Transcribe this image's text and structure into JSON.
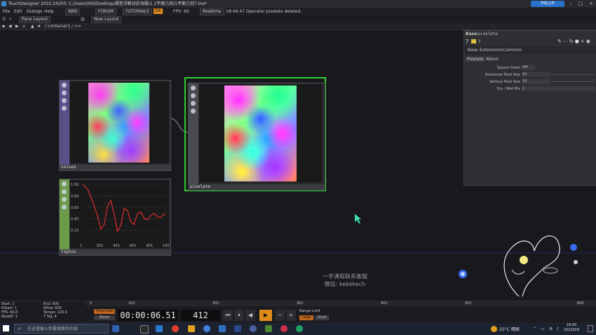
{
  "titlebar": {
    "title": "TouchDesigner 2022.24200: C:/Users/Hill/Desktop/课堂详解动态海报/1.1平面几何/1平面几何7.toe*",
    "upload_label": "开始上传"
  },
  "menubar": {
    "items": [
      "File",
      "Edit",
      "Dialogs",
      "Help"
    ],
    "wiki": "WIKI",
    "forum": "FORUM",
    "tutorials": "TUTORIALS",
    "ok_badge": "OK",
    "fps_label": "FPS:",
    "fps_value": "60",
    "realtime": "Realtime",
    "status_message": "18:46:47 Operator pixelate deleted."
  },
  "toolbar2": {
    "pane_layout": "Pane Layout",
    "new_layout": "New Layout"
  },
  "pathbar": {
    "path": "/ container1 / >>"
  },
  "nodes": {
    "noise": {
      "label": "noise1"
    },
    "pixelate": {
      "label": "pixelate"
    },
    "chop": {
      "label": "topto1",
      "y_ticks": [
        "1.00",
        "0.80",
        "0.60",
        "0.40",
        "0.20"
      ],
      "x_ticks": [
        "1",
        "201",
        "401",
        "601",
        "801",
        "100"
      ]
    }
  },
  "chart_data": {
    "type": "line",
    "title": "",
    "xlabel": "",
    "ylabel": "",
    "xlim": [
      1,
      1000
    ],
    "ylim": [
      0.0,
      1.0
    ],
    "series": [
      {
        "color": "#ff3030",
        "x": [
          1,
          60,
          120,
          180,
          220,
          260,
          300,
          340,
          380,
          420,
          460,
          500,
          540,
          580,
          620,
          660,
          700,
          740,
          780,
          820,
          860,
          900,
          940,
          980,
          1000
        ],
        "y": [
          1.0,
          0.92,
          0.7,
          0.45,
          0.22,
          0.3,
          0.62,
          0.72,
          0.48,
          0.18,
          0.28,
          0.58,
          0.55,
          0.35,
          0.3,
          0.48,
          0.52,
          0.42,
          0.38,
          0.45,
          0.5,
          0.44,
          0.42,
          0.48,
          0.47
        ]
      }
    ]
  },
  "param_panel": {
    "header_type": "Base",
    "header_name": "pixelate",
    "tabs": [
      "Base",
      "Extensions",
      "Common"
    ],
    "subtabs": [
      "Pixelate",
      "About"
    ],
    "params": [
      {
        "label": "Square Pixels",
        "value": "Off"
      },
      {
        "label": "Horizontal Pixel Size",
        "value": "10"
      },
      {
        "label": "Vertical Pixel Size",
        "value": "10"
      },
      {
        "label": "Dry / Wet Mix",
        "value": "1"
      }
    ]
  },
  "watermark": {
    "line1": "一手课程联系客服",
    "line2": "微信: kekekech"
  },
  "timeline": {
    "stats": [
      {
        "label": "Start:",
        "value": "1"
      },
      {
        "label": "RStart:",
        "value": "1"
      },
      {
        "label": "FPS:",
        "value": "60.0"
      },
      {
        "label": "ResetF:",
        "value": "1"
      }
    ],
    "stats2": [
      {
        "label": "End:",
        "value": "600"
      },
      {
        "label": "REnd:",
        "value": "600"
      },
      {
        "label": "Tempo:",
        "value": "120.0"
      },
      {
        "label": "T Sig:",
        "value": "4"
      }
    ],
    "timecode_label": "TimeCode",
    "beats_label": "Beats",
    "timecode": "00:00:06.51",
    "frame": "412",
    "range_limit": "Range Limit",
    "loop": "Loop",
    "once": "Once",
    "ruler_ticks": [
      "1",
      "101",
      "201",
      "301",
      "401",
      "501",
      "600"
    ]
  },
  "taskbar": {
    "search_placeholder": "在这里输入你要搜索的内容",
    "temperature": "25°C 晴朗",
    "time": "18:50",
    "date": "2022/6/9"
  }
}
